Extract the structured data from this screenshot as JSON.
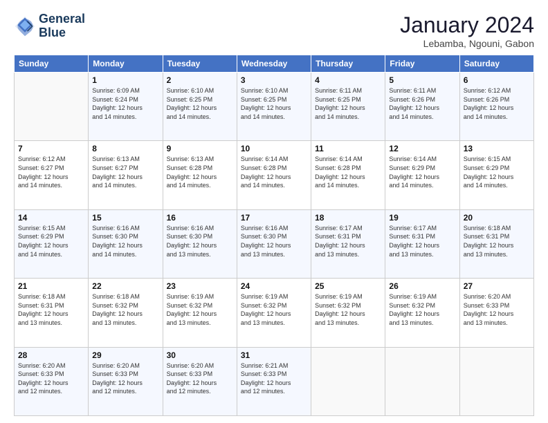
{
  "header": {
    "logo_line1": "General",
    "logo_line2": "Blue",
    "title": "January 2024",
    "subtitle": "Lebamba, Ngouni, Gabon"
  },
  "weekdays": [
    "Sunday",
    "Monday",
    "Tuesday",
    "Wednesday",
    "Thursday",
    "Friday",
    "Saturday"
  ],
  "weeks": [
    [
      {
        "day": "",
        "info": ""
      },
      {
        "day": "1",
        "info": "Sunrise: 6:09 AM\nSunset: 6:24 PM\nDaylight: 12 hours\nand 14 minutes."
      },
      {
        "day": "2",
        "info": "Sunrise: 6:10 AM\nSunset: 6:25 PM\nDaylight: 12 hours\nand 14 minutes."
      },
      {
        "day": "3",
        "info": "Sunrise: 6:10 AM\nSunset: 6:25 PM\nDaylight: 12 hours\nand 14 minutes."
      },
      {
        "day": "4",
        "info": "Sunrise: 6:11 AM\nSunset: 6:25 PM\nDaylight: 12 hours\nand 14 minutes."
      },
      {
        "day": "5",
        "info": "Sunrise: 6:11 AM\nSunset: 6:26 PM\nDaylight: 12 hours\nand 14 minutes."
      },
      {
        "day": "6",
        "info": "Sunrise: 6:12 AM\nSunset: 6:26 PM\nDaylight: 12 hours\nand 14 minutes."
      }
    ],
    [
      {
        "day": "7",
        "info": "Sunrise: 6:12 AM\nSunset: 6:27 PM\nDaylight: 12 hours\nand 14 minutes."
      },
      {
        "day": "8",
        "info": "Sunrise: 6:13 AM\nSunset: 6:27 PM\nDaylight: 12 hours\nand 14 minutes."
      },
      {
        "day": "9",
        "info": "Sunrise: 6:13 AM\nSunset: 6:28 PM\nDaylight: 12 hours\nand 14 minutes."
      },
      {
        "day": "10",
        "info": "Sunrise: 6:14 AM\nSunset: 6:28 PM\nDaylight: 12 hours\nand 14 minutes."
      },
      {
        "day": "11",
        "info": "Sunrise: 6:14 AM\nSunset: 6:28 PM\nDaylight: 12 hours\nand 14 minutes."
      },
      {
        "day": "12",
        "info": "Sunrise: 6:14 AM\nSunset: 6:29 PM\nDaylight: 12 hours\nand 14 minutes."
      },
      {
        "day": "13",
        "info": "Sunrise: 6:15 AM\nSunset: 6:29 PM\nDaylight: 12 hours\nand 14 minutes."
      }
    ],
    [
      {
        "day": "14",
        "info": "Sunrise: 6:15 AM\nSunset: 6:29 PM\nDaylight: 12 hours\nand 14 minutes."
      },
      {
        "day": "15",
        "info": "Sunrise: 6:16 AM\nSunset: 6:30 PM\nDaylight: 12 hours\nand 14 minutes."
      },
      {
        "day": "16",
        "info": "Sunrise: 6:16 AM\nSunset: 6:30 PM\nDaylight: 12 hours\nand 13 minutes."
      },
      {
        "day": "17",
        "info": "Sunrise: 6:16 AM\nSunset: 6:30 PM\nDaylight: 12 hours\nand 13 minutes."
      },
      {
        "day": "18",
        "info": "Sunrise: 6:17 AM\nSunset: 6:31 PM\nDaylight: 12 hours\nand 13 minutes."
      },
      {
        "day": "19",
        "info": "Sunrise: 6:17 AM\nSunset: 6:31 PM\nDaylight: 12 hours\nand 13 minutes."
      },
      {
        "day": "20",
        "info": "Sunrise: 6:18 AM\nSunset: 6:31 PM\nDaylight: 12 hours\nand 13 minutes."
      }
    ],
    [
      {
        "day": "21",
        "info": "Sunrise: 6:18 AM\nSunset: 6:31 PM\nDaylight: 12 hours\nand 13 minutes."
      },
      {
        "day": "22",
        "info": "Sunrise: 6:18 AM\nSunset: 6:32 PM\nDaylight: 12 hours\nand 13 minutes."
      },
      {
        "day": "23",
        "info": "Sunrise: 6:19 AM\nSunset: 6:32 PM\nDaylight: 12 hours\nand 13 minutes."
      },
      {
        "day": "24",
        "info": "Sunrise: 6:19 AM\nSunset: 6:32 PM\nDaylight: 12 hours\nand 13 minutes."
      },
      {
        "day": "25",
        "info": "Sunrise: 6:19 AM\nSunset: 6:32 PM\nDaylight: 12 hours\nand 13 minutes."
      },
      {
        "day": "26",
        "info": "Sunrise: 6:19 AM\nSunset: 6:32 PM\nDaylight: 12 hours\nand 13 minutes."
      },
      {
        "day": "27",
        "info": "Sunrise: 6:20 AM\nSunset: 6:33 PM\nDaylight: 12 hours\nand 13 minutes."
      }
    ],
    [
      {
        "day": "28",
        "info": "Sunrise: 6:20 AM\nSunset: 6:33 PM\nDaylight: 12 hours\nand 12 minutes."
      },
      {
        "day": "29",
        "info": "Sunrise: 6:20 AM\nSunset: 6:33 PM\nDaylight: 12 hours\nand 12 minutes."
      },
      {
        "day": "30",
        "info": "Sunrise: 6:20 AM\nSunset: 6:33 PM\nDaylight: 12 hours\nand 12 minutes."
      },
      {
        "day": "31",
        "info": "Sunrise: 6:21 AM\nSunset: 6:33 PM\nDaylight: 12 hours\nand 12 minutes."
      },
      {
        "day": "",
        "info": ""
      },
      {
        "day": "",
        "info": ""
      },
      {
        "day": "",
        "info": ""
      }
    ]
  ]
}
